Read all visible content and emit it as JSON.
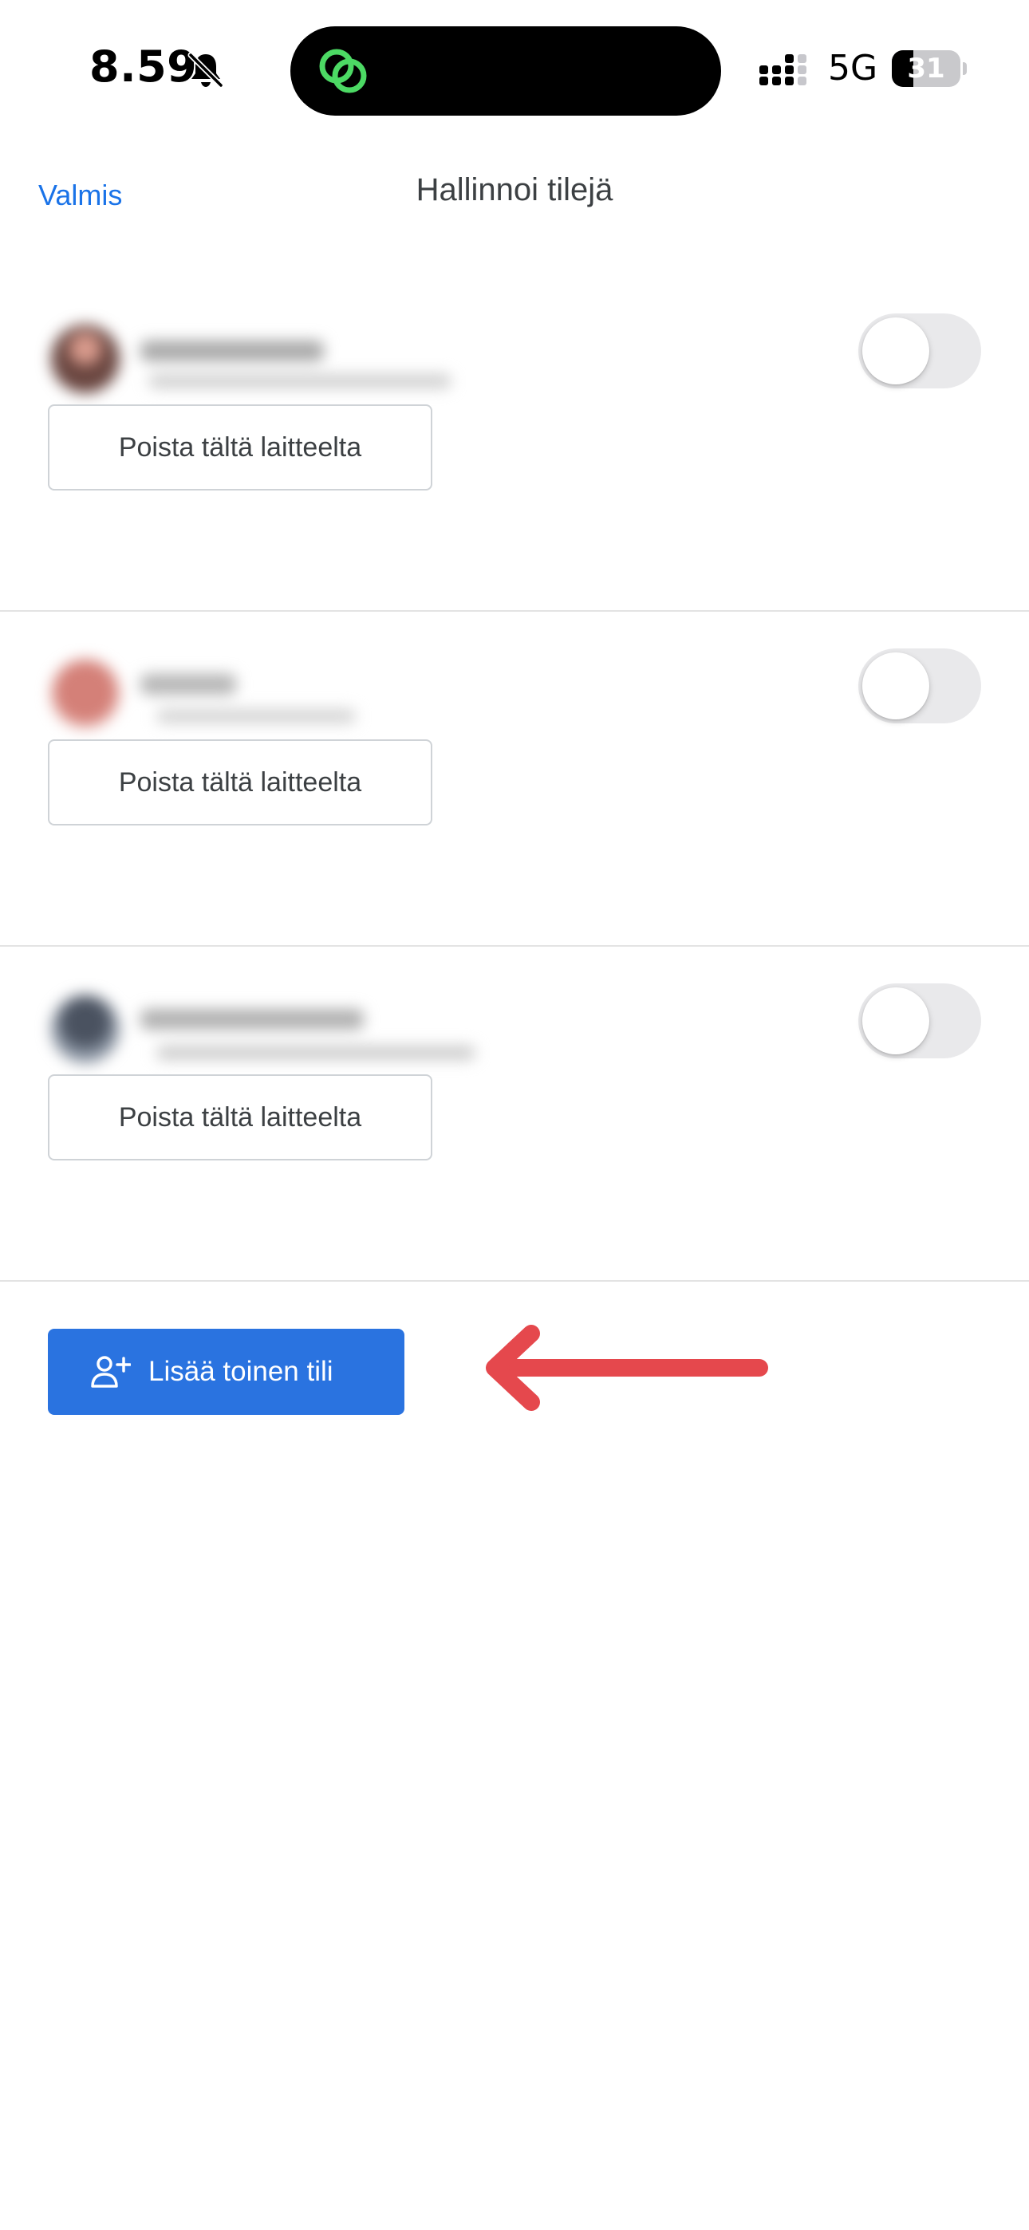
{
  "status_bar": {
    "time": "8.59",
    "network": "5G",
    "battery": "31",
    "battery_level_percent": 31,
    "silent_icon": "bell-slash-icon",
    "signal_icon": "cellular-signal-icon",
    "island_app_icon": "linked-circles-icon"
  },
  "header": {
    "done_label": "Valmis",
    "title": "Hallinnoi tilejä"
  },
  "accounts": [
    {
      "remove_label": "Poista tältä laitteelta",
      "avatar_color": "#8a5a52",
      "toggle_on": false
    },
    {
      "remove_label": "Poista tältä laitteelta",
      "avatar_color": "#c9736a",
      "toggle_on": false
    },
    {
      "remove_label": "Poista tältä laitteelta",
      "avatar_color": "#5a6270",
      "toggle_on": false
    }
  ],
  "add_account": {
    "label": "Lisää toinen tili",
    "icon": "add-person-icon"
  },
  "colors": {
    "accent": "#1a73e8",
    "primary_button": "#2a73e0",
    "annotation_arrow": "#e5484d",
    "island_icon": "#4cd964"
  }
}
